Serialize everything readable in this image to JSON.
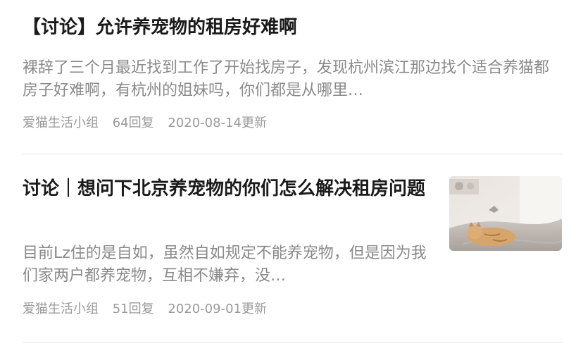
{
  "posts": [
    {
      "title": "【讨论】允许养宠物的租房好难啊",
      "excerpt": "裸辞了三个月最近找到工作了开始找房子，发现杭州滨江那边找个适合养猫都房子好难啊，有杭州的姐妹吗，你们都是从哪里…",
      "group": "爱猫生活小组",
      "replies": "64回复",
      "updated": "2020-08-14更新"
    },
    {
      "title": "讨论｜想问下北京养宠物的你们怎么解决租房问题",
      "excerpt": "目前Lz住的是自如，虽然自如规定不能养宠物，但是因为我们家两户都养宠物，互相不嫌弃，没…",
      "group": "爱猫生活小组",
      "replies": "51回复",
      "updated": "2020-09-01更新",
      "thumbnail": "cat-lying-on-bed-photo"
    }
  ]
}
